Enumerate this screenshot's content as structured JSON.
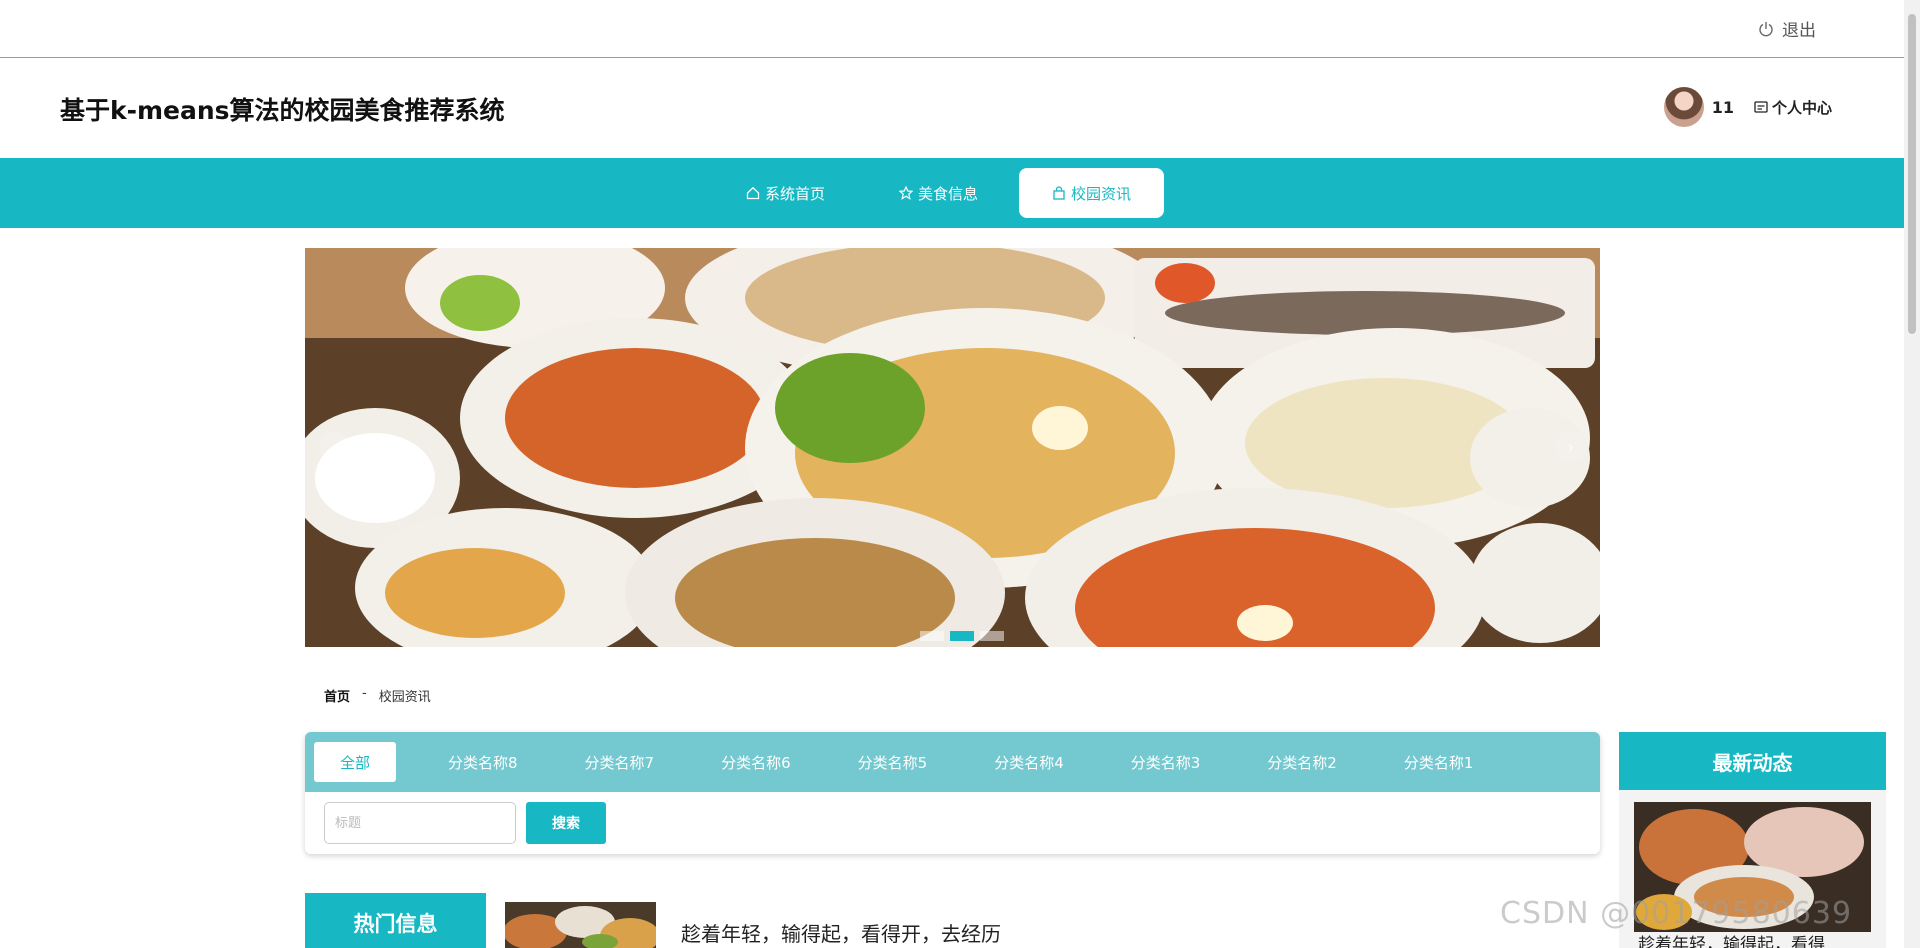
{
  "topbar": {
    "logout_label": "退出"
  },
  "header": {
    "title": "基于k-means算法的校园美食推荐系统",
    "username": "11",
    "personal_center_label": "个人中心"
  },
  "nav": {
    "items": [
      {
        "label": "系统首页",
        "icon": "home-icon"
      },
      {
        "label": "美食信息",
        "icon": "star-icon"
      },
      {
        "label": "校园资讯",
        "icon": "bag-icon",
        "active": true
      }
    ]
  },
  "banner": {
    "slide_count": 3,
    "active_index": 1
  },
  "breadcrumb": {
    "home": "首页",
    "separator": "-",
    "current": "校园资讯"
  },
  "categories": {
    "items": [
      "全部",
      "分类名称8",
      "分类名称7",
      "分类名称6",
      "分类名称5",
      "分类名称4",
      "分类名称3",
      "分类名称2",
      "分类名称1"
    ],
    "active": "全部"
  },
  "search": {
    "placeholder": "标题",
    "value": "",
    "button_label": "搜索"
  },
  "hot": {
    "title": "热门信息",
    "first_item_title": "趁着年轻，输得起，看得开，去经历"
  },
  "latest": {
    "title": "最新动态",
    "first_item_title": "趁着年轻，输得起，看得"
  },
  "watermark": "CSDN @00179580639",
  "colors": {
    "accent": "#17b8c3",
    "category_bar": "#73c9cf"
  }
}
